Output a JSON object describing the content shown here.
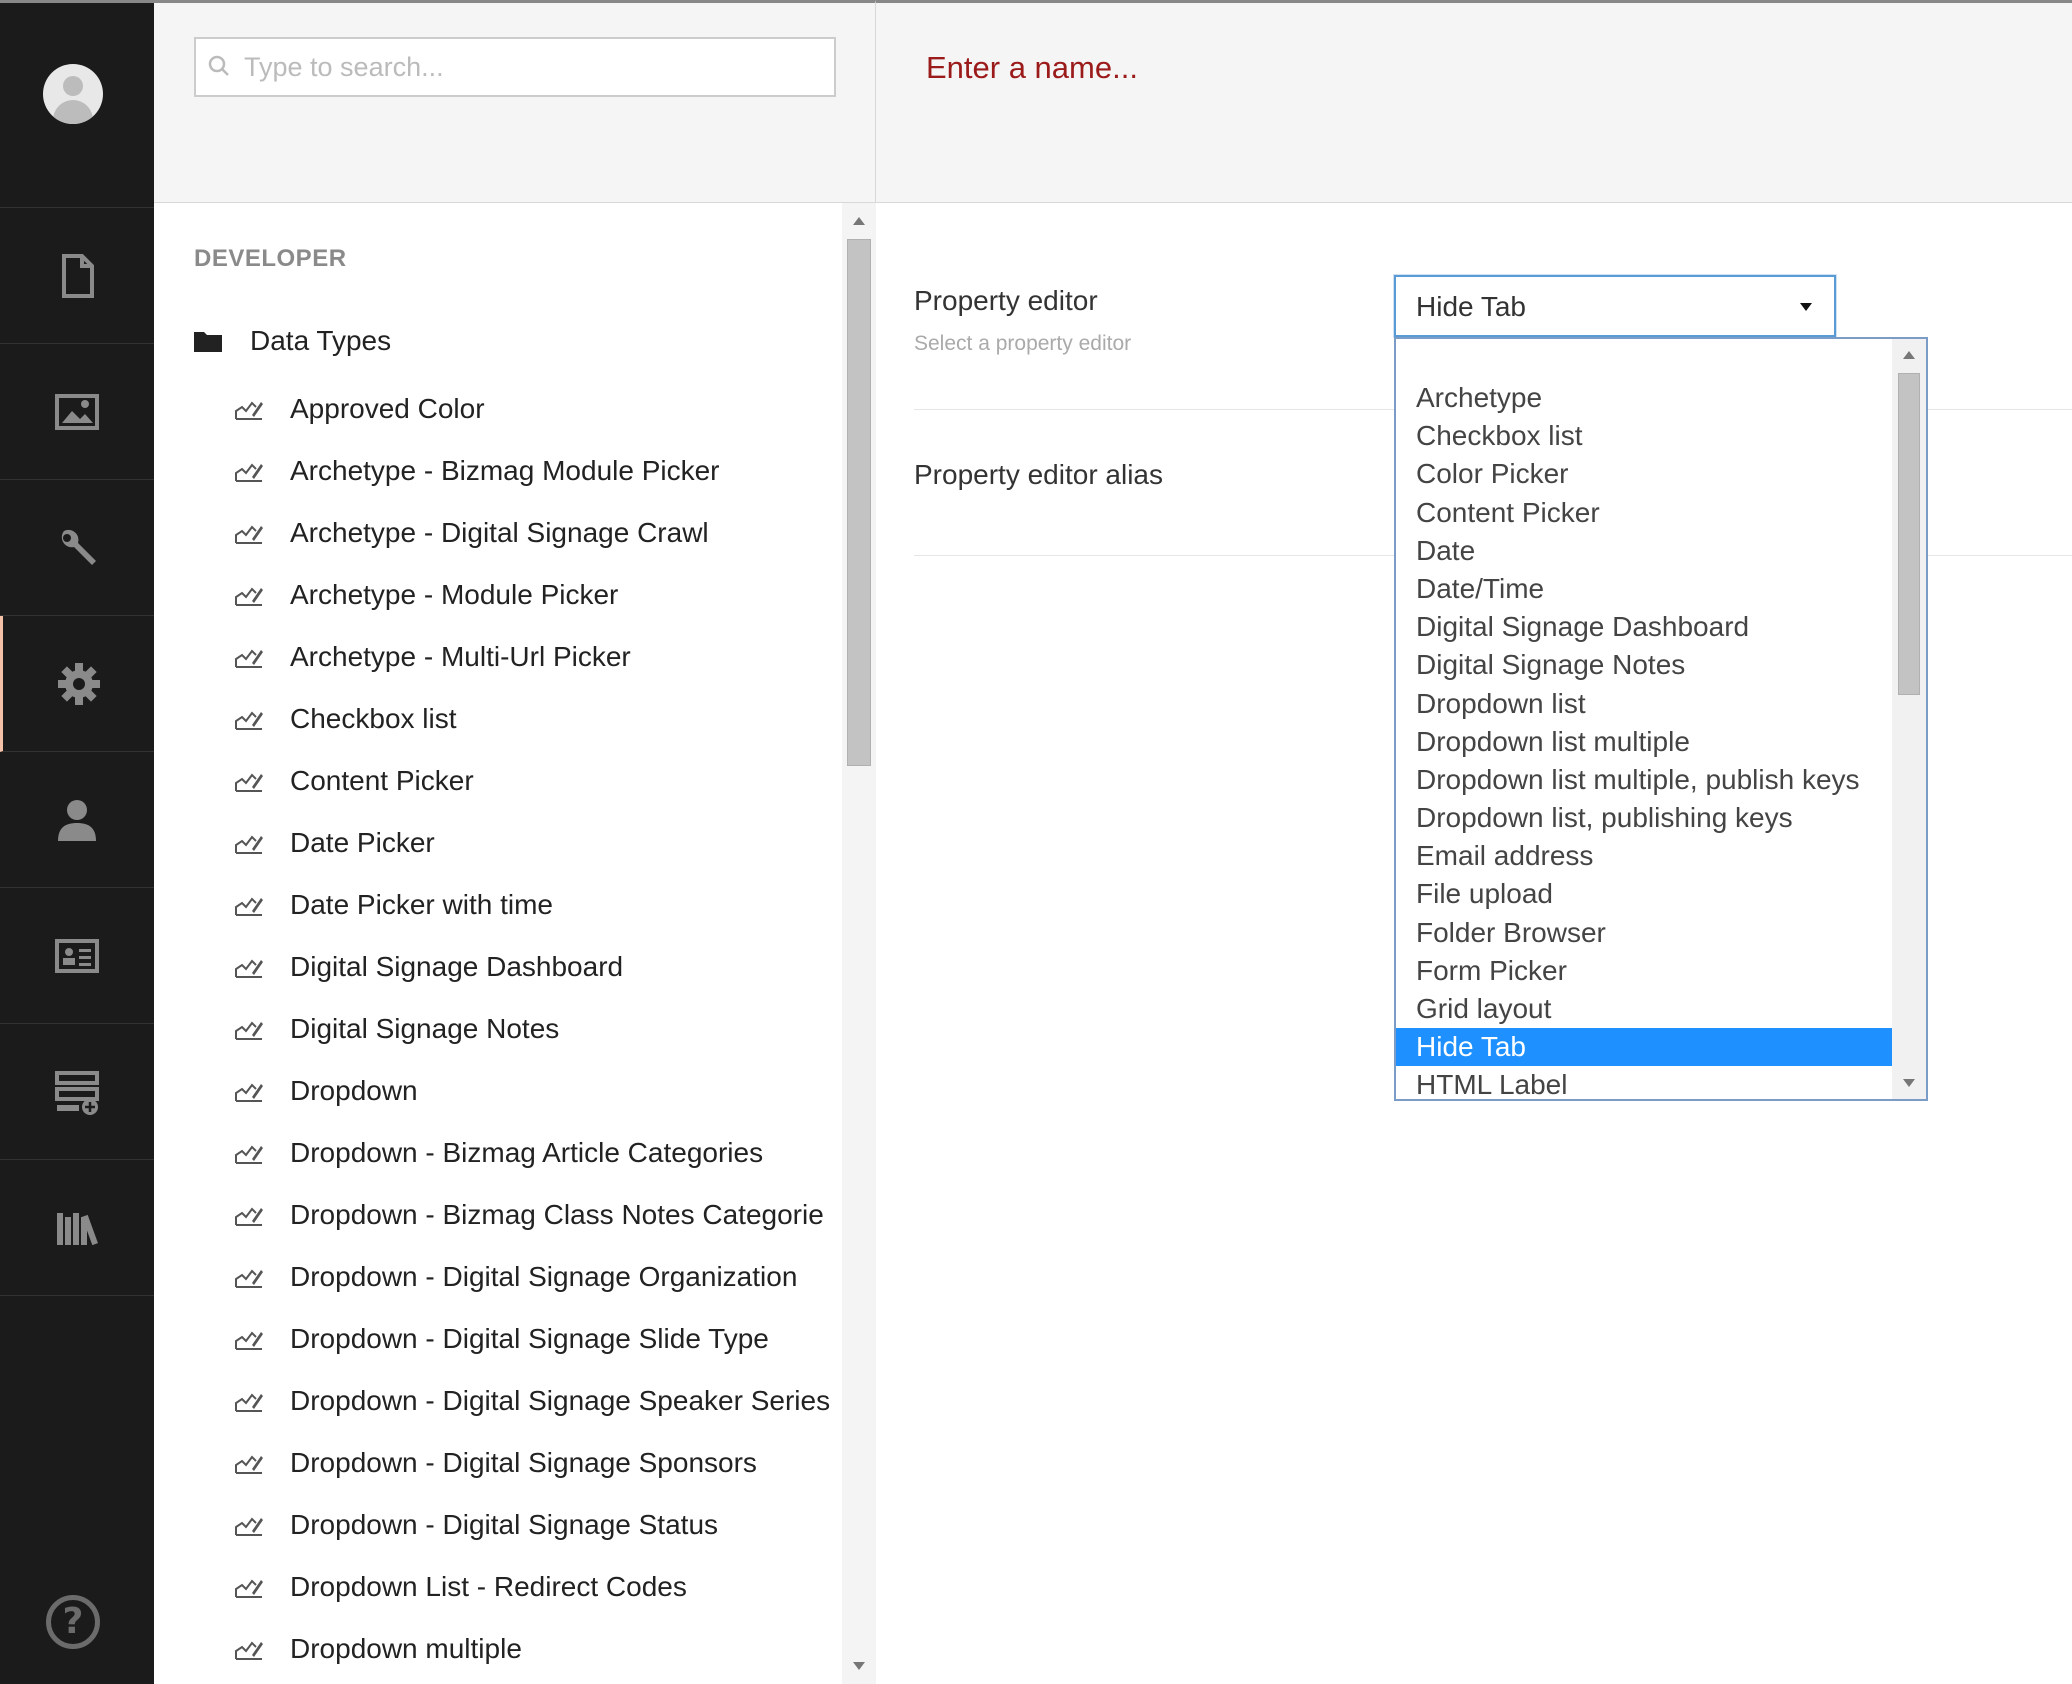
{
  "nav": {
    "items": [
      {
        "icon": "document-icon",
        "label": "Content"
      },
      {
        "icon": "image-icon",
        "label": "Media"
      },
      {
        "icon": "wrench-icon",
        "label": "Settings"
      },
      {
        "icon": "gear-icon",
        "label": "Developer",
        "active": true
      },
      {
        "icon": "user-icon",
        "label": "Users"
      },
      {
        "icon": "member-card-icon",
        "label": "Members"
      },
      {
        "icon": "forms-icon",
        "label": "Forms"
      },
      {
        "icon": "library-icon",
        "label": "Translation"
      }
    ],
    "help_glyph": "?"
  },
  "search": {
    "placeholder": "Type to search..."
  },
  "tree": {
    "section_title": "DEVELOPER",
    "root_label": "Data Types",
    "items": [
      "Approved Color",
      "Archetype - Bizmag Module Picker",
      "Archetype - Digital Signage Crawl",
      "Archetype - Module Picker",
      "Archetype - Multi-Url Picker",
      "Checkbox list",
      "Content Picker",
      "Date Picker",
      "Date Picker with time",
      "Digital Signage Dashboard",
      "Digital Signage Notes",
      "Dropdown",
      "Dropdown - Bizmag Article Categories",
      "Dropdown - Bizmag Class Notes Categorie",
      "Dropdown - Digital Signage Organization",
      "Dropdown - Digital Signage Slide Type",
      "Dropdown - Digital Signage Speaker Series",
      "Dropdown - Digital Signage Sponsors",
      "Dropdown - Digital Signage Status",
      "Dropdown List - Redirect Codes",
      "Dropdown multiple"
    ]
  },
  "editor": {
    "name_placeholder": "Enter a name...",
    "property_editor_label": "Property editor",
    "property_editor_desc": "Select a property editor",
    "property_editor_alias_label": "Property editor alias",
    "selected_value": "Hide Tab",
    "options": [
      "Archetype",
      "Checkbox list",
      "Color Picker",
      "Content Picker",
      "Date",
      "Date/Time",
      "Digital Signage Dashboard",
      "Digital Signage Notes",
      "Dropdown list",
      "Dropdown list multiple",
      "Dropdown list multiple, publish keys",
      "Dropdown list, publishing keys",
      "Email address",
      "File upload",
      "Folder Browser",
      "Form Picker",
      "Grid layout",
      "Hide Tab",
      "HTML Label"
    ]
  },
  "colors": {
    "nav_bg": "#1b1b1b",
    "name_placeholder": "#9b1b1b",
    "selection": "#1e90ff"
  }
}
